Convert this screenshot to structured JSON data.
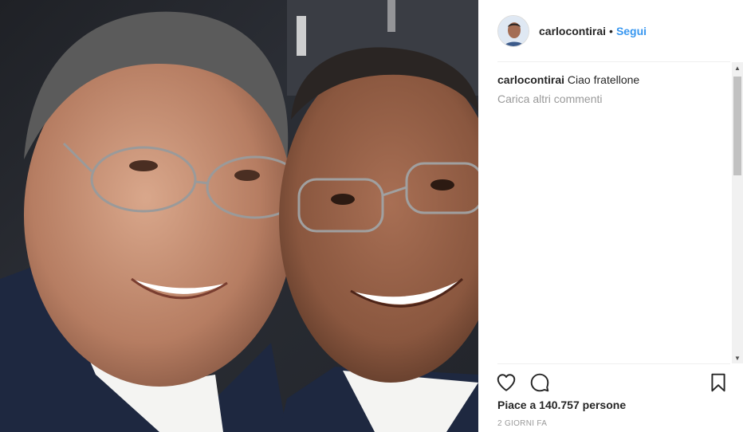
{
  "post": {
    "username": "carlocontirai",
    "separator": "•",
    "follow_label": "Segui",
    "comments": [
      {
        "user": "carlocontirai",
        "text": "Ciao fratellone"
      }
    ],
    "load_more_label": "Carica altri commenti",
    "likes_text": "Piace a 140.757 persone",
    "timestamp": "2 GIORNI FA"
  },
  "icons": {
    "like": "heart-icon",
    "comment": "comment-icon",
    "save": "bookmark-icon"
  },
  "colors": {
    "link_blue": "#3897f0",
    "text": "#262626",
    "muted": "#999999"
  }
}
